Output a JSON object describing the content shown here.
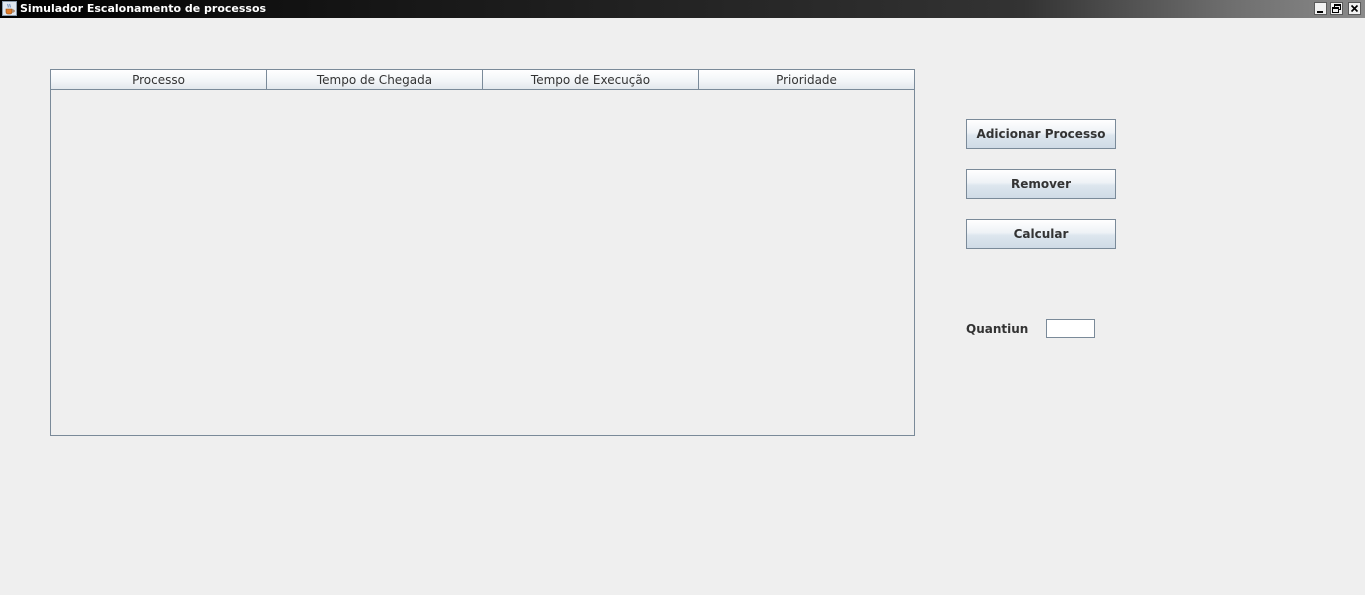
{
  "window": {
    "title": "Simulador Escalonamento de processos",
    "icon": "java-coffee-cup-icon",
    "controls": [
      "minimize-icon",
      "restore-icon",
      "close-icon"
    ]
  },
  "table": {
    "columns": [
      "Processo",
      "Tempo de Chegada",
      "Tempo de Execução",
      "Prioridade"
    ],
    "rows": []
  },
  "actions": {
    "add_label": "Adicionar Processo",
    "remove_label": "Remover",
    "calculate_label": "Calcular"
  },
  "quantum": {
    "label": "Quantiun",
    "value": ""
  },
  "colors": {
    "background": "#efefef",
    "border": "#7a8a99",
    "text": "#333333"
  }
}
